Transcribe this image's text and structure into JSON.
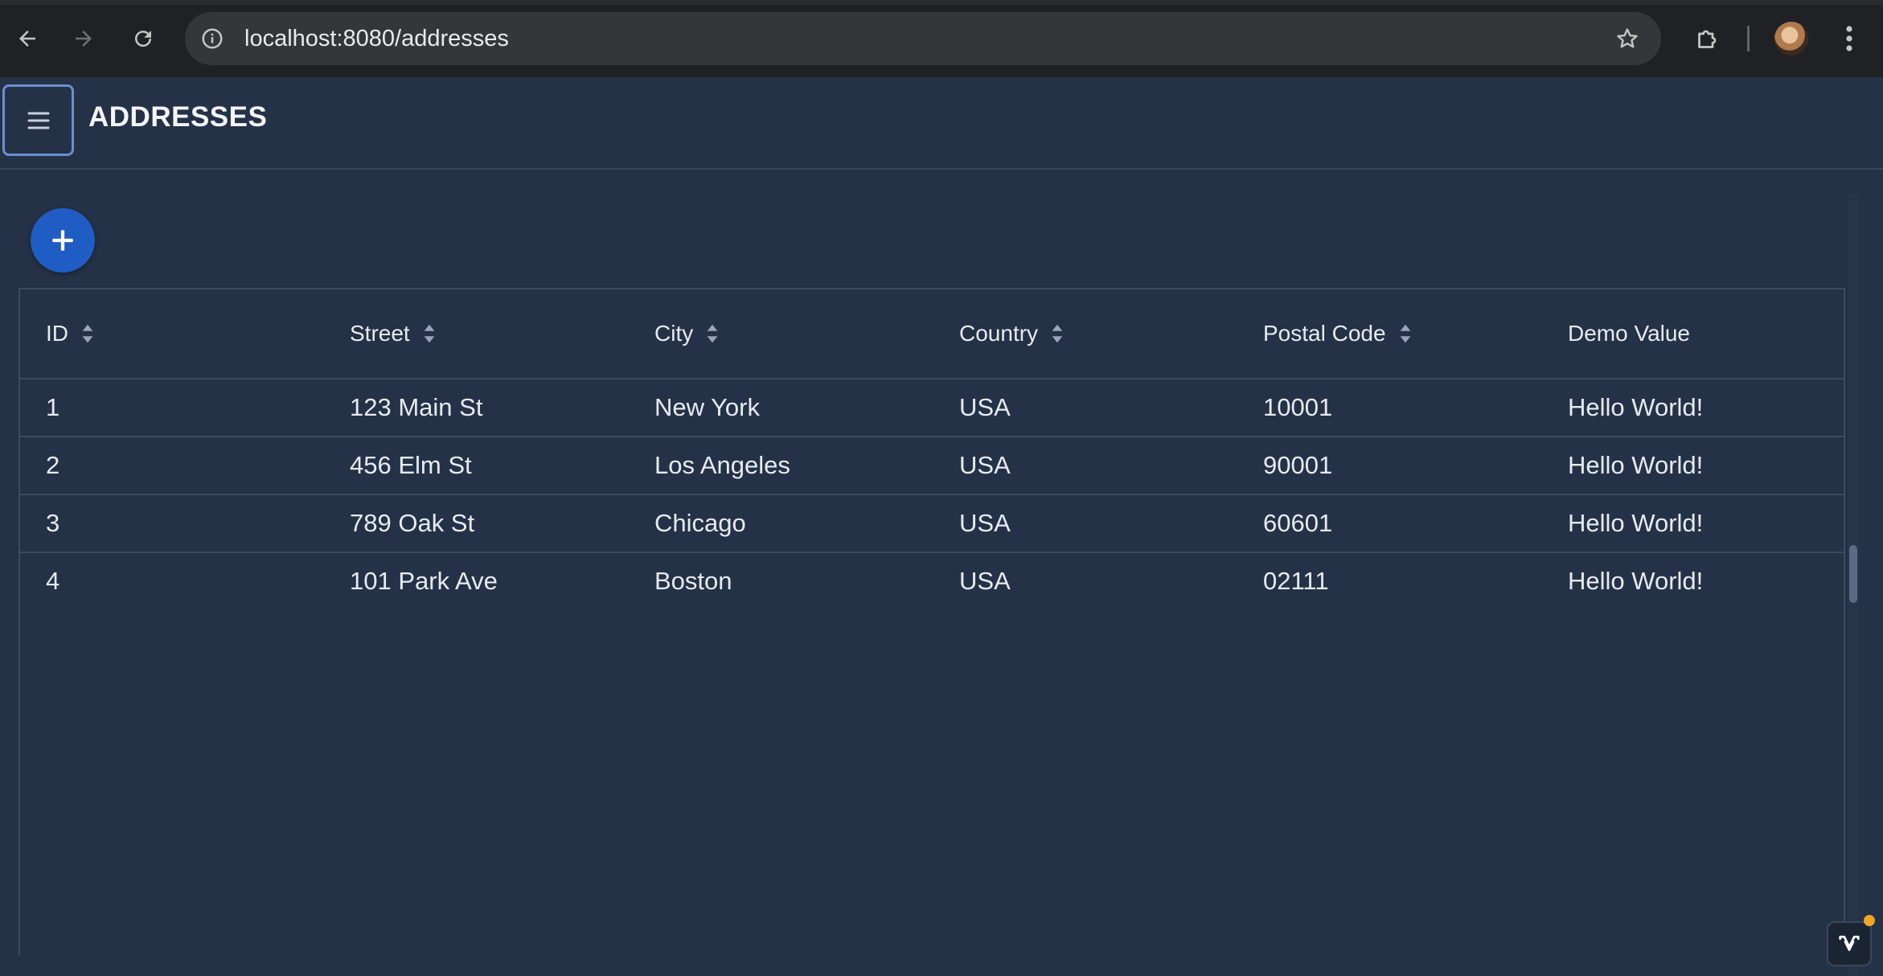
{
  "browser": {
    "url": "localhost:8080/addresses",
    "icons": [
      "back-arrow-icon",
      "forward-arrow-icon",
      "reload-icon",
      "site-info-icon",
      "bookmark-star-icon",
      "extensions-icon",
      "avatar",
      "more-vert-icon"
    ]
  },
  "app": {
    "title": "ADDRESSES",
    "menu_icon": "hamburger-menu-icon",
    "add_icon": "plus-icon"
  },
  "grid": {
    "columns": [
      {
        "label": "ID",
        "sortable": true
      },
      {
        "label": "Street",
        "sortable": true
      },
      {
        "label": "City",
        "sortable": true
      },
      {
        "label": "Country",
        "sortable": true
      },
      {
        "label": "Postal Code",
        "sortable": true
      },
      {
        "label": "Demo Value",
        "sortable": false
      }
    ],
    "rows": [
      [
        "1",
        "123 Main St",
        "New York",
        "USA",
        "10001",
        "Hello World!"
      ],
      [
        "2",
        "456 Elm St",
        "Los Angeles",
        "USA",
        "90001",
        "Hello World!"
      ],
      [
        "3",
        "789 Oak St",
        "Chicago",
        "USA",
        "60601",
        "Hello World!"
      ],
      [
        "4",
        "101 Park Ave",
        "Boston",
        "USA",
        "02111",
        "Hello World!"
      ]
    ]
  },
  "colors": {
    "background": "#243146",
    "accent": "#1f5dc4",
    "focus_ring": "#6b8fcf",
    "notification_dot": "#f0a623"
  }
}
